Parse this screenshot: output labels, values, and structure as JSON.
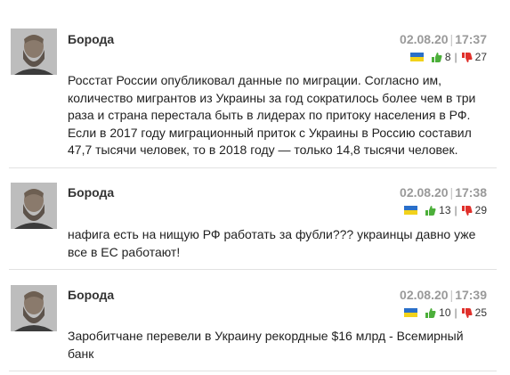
{
  "comments": [
    {
      "author": "Борода",
      "date": "02.08.20",
      "time": "17:37",
      "likes": "8",
      "dislikes": "27",
      "text": "Росстат России опубликовал данные по миграции. Согласно им, количество мигрантов из Украины за год сократилось более чем в три раза и страна перестала быть в лидерах по притоку населения в РФ. Если в 2017 году миграционный приток с Украины в Россию составил 47,7 тысячи человек, то в 2018 году — только 14,8 тысячи человек."
    },
    {
      "author": "Борода",
      "date": "02.08.20",
      "time": "17:38",
      "likes": "13",
      "dislikes": "29",
      "text": "нафига есть на нищую РФ работать за фубли??? украинцы давно уже все в ЕС работают!"
    },
    {
      "author": "Борода",
      "date": "02.08.20",
      "time": "17:39",
      "likes": "10",
      "dislikes": "25",
      "text": "Заробитчане перевели в Украину рекордные $16 млрд - Всемирный банк"
    }
  ],
  "colors": {
    "like": "#4caf3a",
    "dislike": "#e0302b",
    "flag_blue": "#2a6fc9",
    "flag_yellow": "#f2d21b"
  },
  "icons": {
    "avatar": "bearded-man-portrait",
    "like": "thumbs-up-icon",
    "dislike": "thumbs-down-icon",
    "flag": "ukraine-flag-icon"
  }
}
